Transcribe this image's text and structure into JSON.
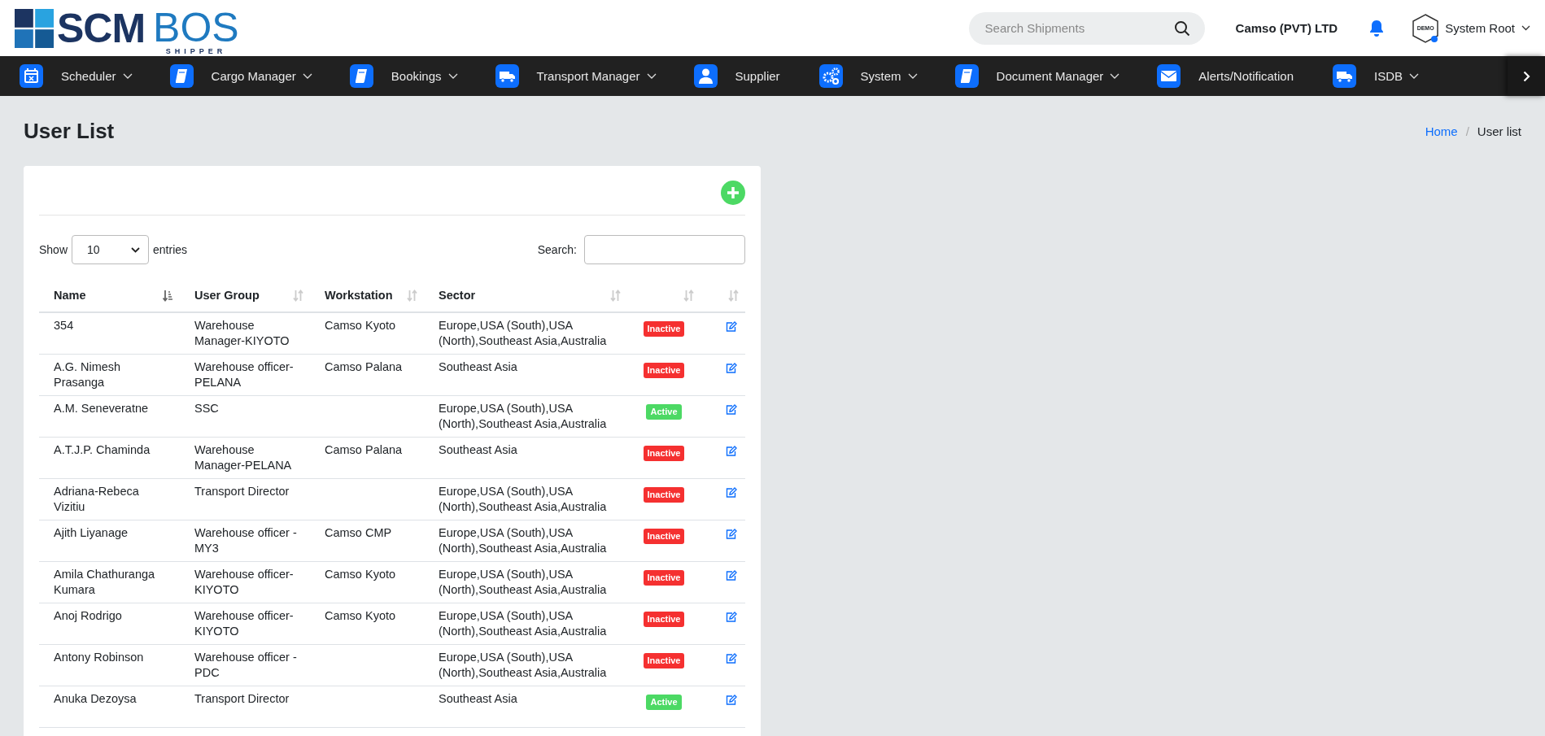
{
  "logo": {
    "primary": "SCM",
    "secondary": "BOS",
    "tagline": "SHIPPER"
  },
  "search": {
    "placeholder": "Search Shipments"
  },
  "company": "Camso (PVT) LTD",
  "user": {
    "badge": "DEMO",
    "name": "System Root"
  },
  "nav": [
    {
      "label": "Scheduler",
      "kind": "calendar",
      "dropdown": true
    },
    {
      "label": "Cargo Manager",
      "kind": "book",
      "dropdown": true
    },
    {
      "label": "Bookings",
      "kind": "book",
      "dropdown": true
    },
    {
      "label": "Transport Manager",
      "kind": "truck",
      "dropdown": true
    },
    {
      "label": "Supplier",
      "kind": "user",
      "dropdown": false
    },
    {
      "label": "System",
      "kind": "gears",
      "dropdown": true
    },
    {
      "label": "Document Manager",
      "kind": "book",
      "dropdown": true
    },
    {
      "label": "Alerts/Notification",
      "kind": "envelope",
      "dropdown": false
    },
    {
      "label": "ISDB",
      "kind": "truck",
      "dropdown": true
    }
  ],
  "page_title": "User List",
  "breadcrumb_separator": "/",
  "breadcrumb": [
    {
      "label": "Home",
      "selected": false
    },
    {
      "label": "User list",
      "selected": true
    }
  ],
  "length_menu": {
    "before": "Show",
    "value": "10",
    "after": "entries"
  },
  "table_search": {
    "label": "Search:"
  },
  "table": {
    "columns": [
      {
        "label": "Name",
        "sorted": true
      },
      {
        "label": "User Group",
        "sorted": false
      },
      {
        "label": "Workstation",
        "sorted": false
      },
      {
        "label": "Sector",
        "sorted": false
      },
      {
        "sorted": false
      },
      {
        "sorted": false
      }
    ],
    "rows": [
      {
        "name": "354",
        "group": "Warehouse Manager-KIYOTO",
        "workstation": "Camso Kyoto",
        "sector": "Europe,USA (South),USA (North),Southeast Asia,Australia",
        "status": "Inactive",
        "active": false
      },
      {
        "name": "A.G. Nimesh Prasanga",
        "group": "Warehouse officer-PELANA",
        "workstation": "Camso Palana",
        "sector": "Southeast Asia",
        "status": "Inactive",
        "active": false
      },
      {
        "name": "A.M. Seneveratne",
        "group": "SSC",
        "sector": "Europe,USA (South),USA (North),Southeast Asia,Australia",
        "status": "Active",
        "active": true
      },
      {
        "name": "A.T.J.P. Chaminda",
        "group": "Warehouse Manager-PELANA",
        "workstation": "Camso Palana",
        "sector": "Southeast Asia",
        "status": "Inactive",
        "active": false
      },
      {
        "name": "Adriana-Rebeca Vizitiu",
        "group": "Transport Director",
        "sector": "Europe,USA (South),USA (North),Southeast Asia,Australia",
        "status": "Inactive",
        "active": false
      },
      {
        "name": "Ajith Liyanage",
        "group": "Warehouse officer - MY3",
        "workstation": "Camso CMP",
        "sector": "Europe,USA (South),USA (North),Southeast Asia,Australia",
        "status": "Inactive",
        "active": false
      },
      {
        "name": "Amila Chathuranga Kumara",
        "group": "Warehouse officer-KIYOTO",
        "workstation": "Camso Kyoto",
        "sector": "Europe,USA (South),USA (North),Southeast Asia,Australia",
        "status": "Inactive",
        "active": false
      },
      {
        "name": "Anoj Rodrigo",
        "group": "Warehouse officer-KIYOTO",
        "workstation": "Camso Kyoto",
        "sector": "Europe,USA (South),USA (North),Southeast Asia,Australia",
        "status": "Inactive",
        "active": false
      },
      {
        "name": "Antony Robinson",
        "group": "Warehouse officer - PDC",
        "sector": "Europe,USA (South),USA (North),Southeast Asia,Australia",
        "status": "Inactive",
        "active": false
      },
      {
        "name": "Anuka Dezoysa",
        "group": "Transport Director",
        "sector": "Southeast Asia",
        "status": "Active",
        "active": true
      }
    ]
  }
}
